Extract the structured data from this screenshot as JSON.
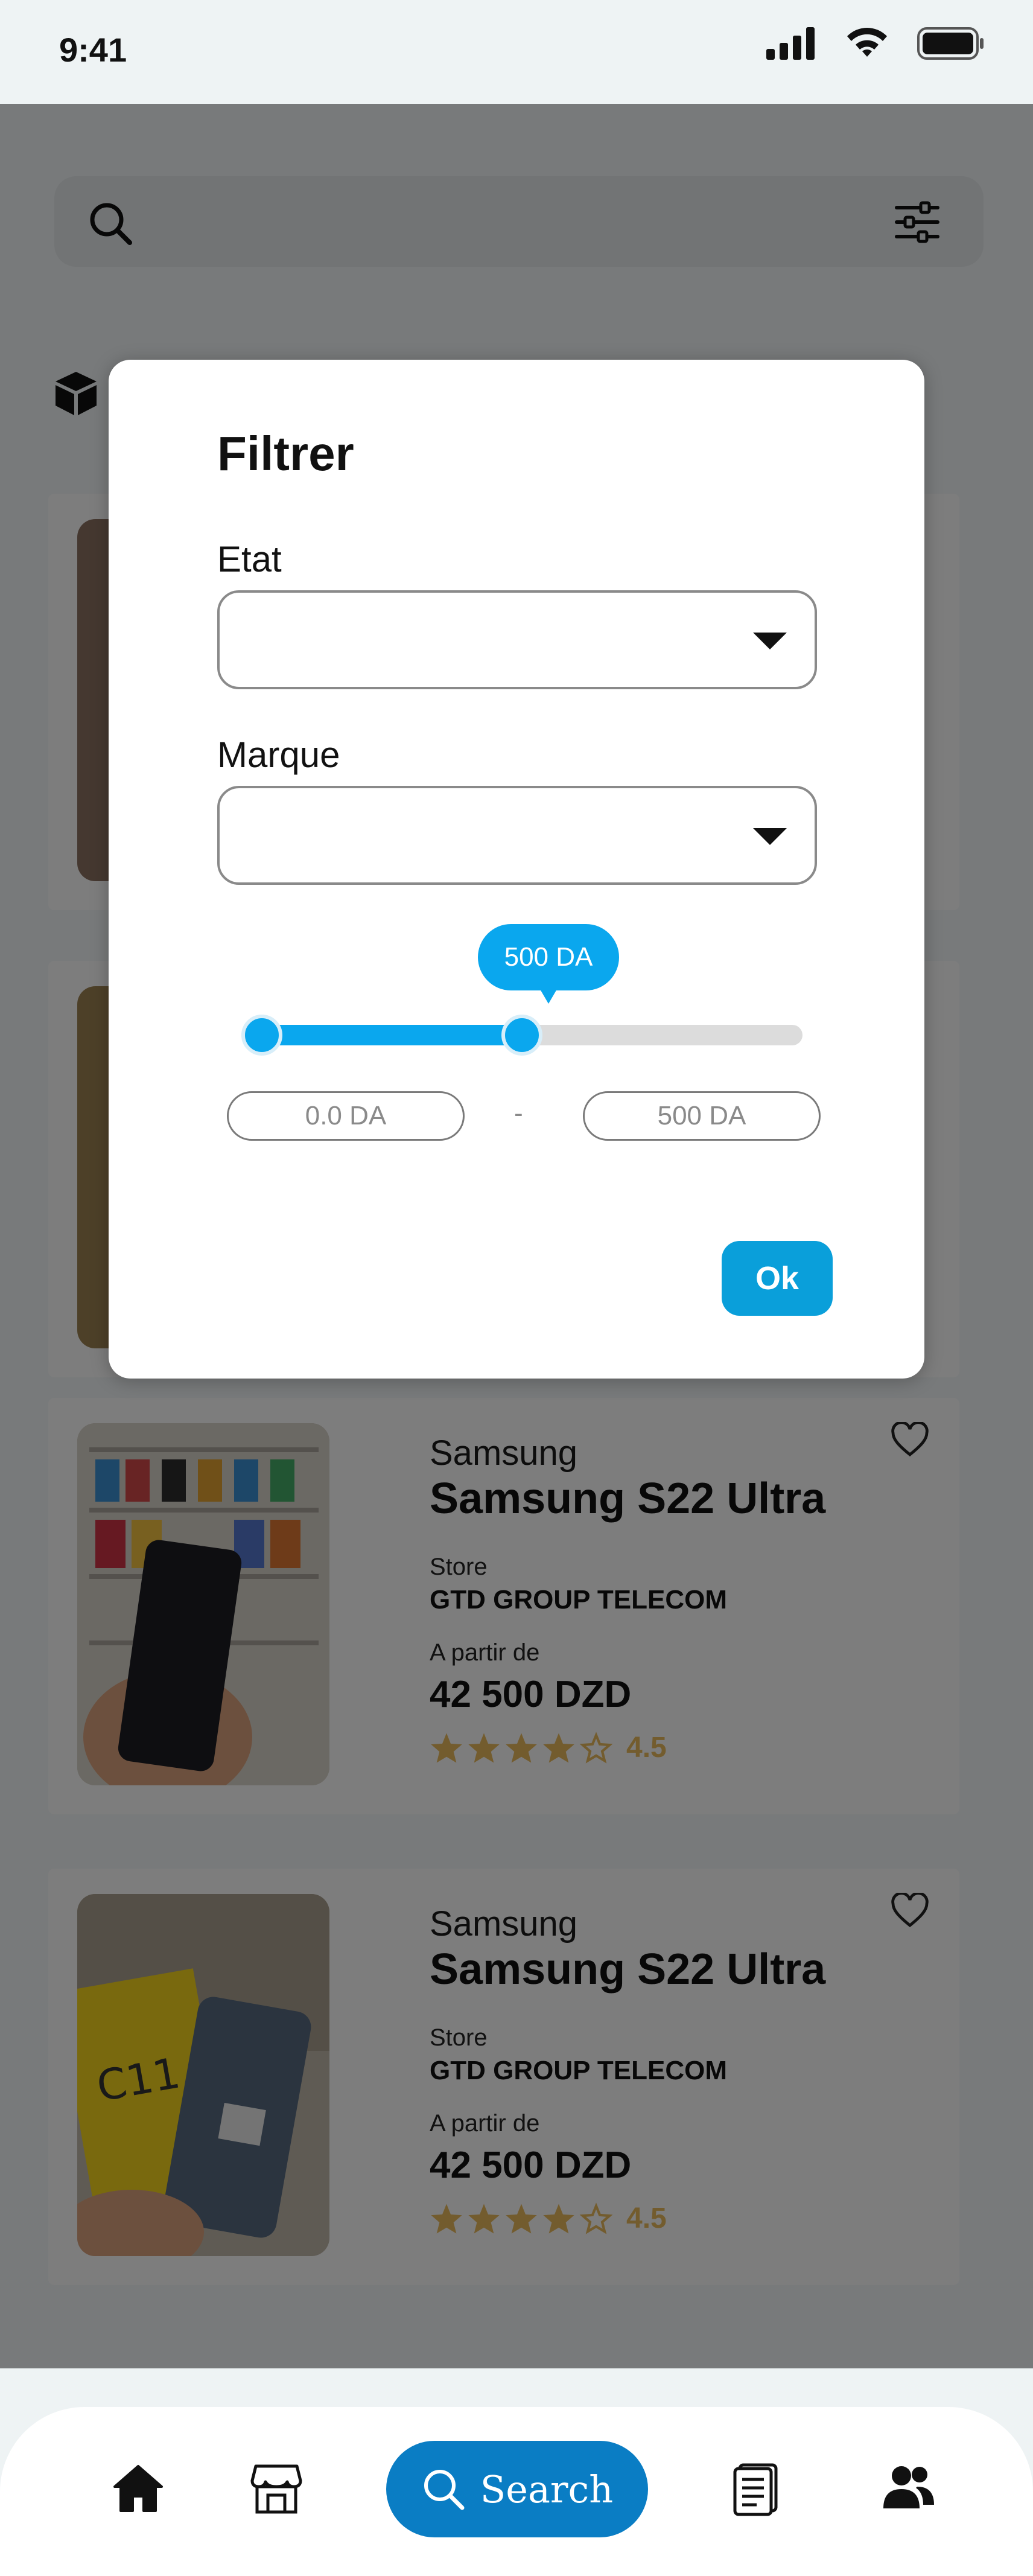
{
  "status_bar": {
    "time": "9:41"
  },
  "category_icon": "box-icon",
  "products": [
    {
      "brand": "Samsung",
      "title": "Samsung S22 Ultra",
      "store_label": "Store",
      "store_name": "GTD GROUP TELECOM",
      "price_label": "A partir de",
      "price": "42 500 DZD",
      "rating": "4.5",
      "rating_stars": 4
    },
    {
      "brand": "Samsung",
      "title": "Samsung S22 Ultra",
      "store_label": "Store",
      "store_name": "GTD GROUP TELECOM",
      "price_label": "A partir de",
      "price": "42 500 DZD",
      "rating": "4.5",
      "rating_stars": 4
    }
  ],
  "filter": {
    "title": "Filtrer",
    "etat_label": "Etat",
    "etat_value": "",
    "marque_label": "Marque",
    "marque_value": "",
    "slider_bubble": "500 DA",
    "slider_min_value": 0,
    "slider_max_value": 0.5,
    "min_price": "0.0 DA",
    "separator": "-",
    "max_price": "500 DA",
    "ok_label": "Ok"
  },
  "bottom_nav": {
    "search_label": "Search",
    "items": [
      "home-icon",
      "store-icon",
      "search-icon",
      "orders-icon",
      "users-icon"
    ]
  },
  "colors": {
    "accent": "#0aa7ee",
    "nav_accent": "#0a7dc4",
    "star": "#e6b85c"
  }
}
